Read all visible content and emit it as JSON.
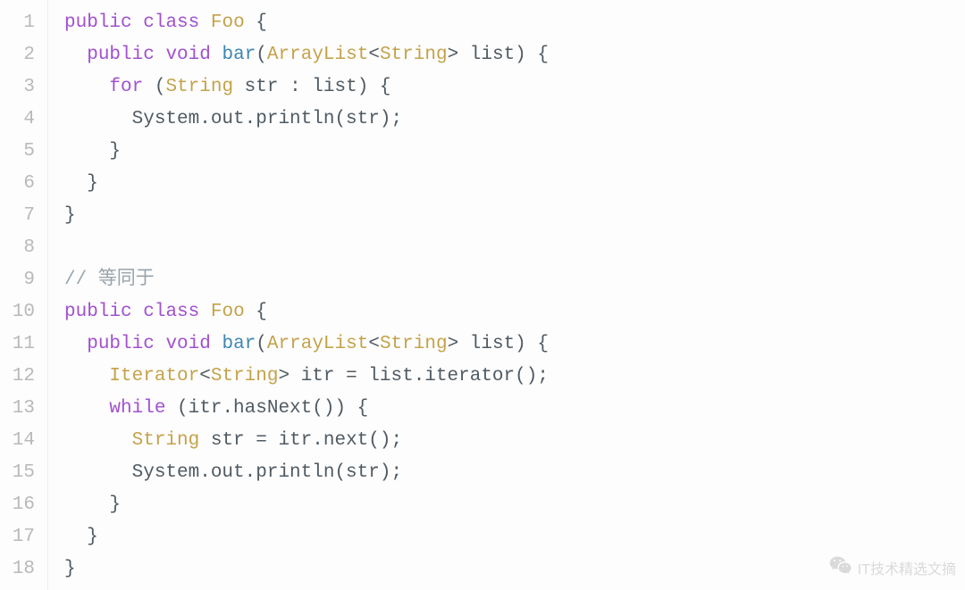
{
  "lines": [
    {
      "n": 1,
      "tokens": [
        [
          "kw",
          "public"
        ],
        [
          "plain",
          " "
        ],
        [
          "kw",
          "class"
        ],
        [
          "plain",
          " "
        ],
        [
          "type",
          "Foo"
        ],
        [
          "plain",
          " {"
        ]
      ]
    },
    {
      "n": 2,
      "tokens": [
        [
          "plain",
          "  "
        ],
        [
          "kw",
          "public"
        ],
        [
          "plain",
          " "
        ],
        [
          "kw",
          "void"
        ],
        [
          "plain",
          " "
        ],
        [
          "fn",
          "bar"
        ],
        [
          "plain",
          "("
        ],
        [
          "type",
          "ArrayList"
        ],
        [
          "plain",
          "<"
        ],
        [
          "type",
          "String"
        ],
        [
          "plain",
          "> list) {"
        ]
      ]
    },
    {
      "n": 3,
      "tokens": [
        [
          "plain",
          "    "
        ],
        [
          "kw",
          "for"
        ],
        [
          "plain",
          " ("
        ],
        [
          "type",
          "String"
        ],
        [
          "plain",
          " str : list) {"
        ]
      ]
    },
    {
      "n": 4,
      "tokens": [
        [
          "plain",
          "      System.out.println(str);"
        ]
      ]
    },
    {
      "n": 5,
      "tokens": [
        [
          "plain",
          "    }"
        ]
      ]
    },
    {
      "n": 6,
      "tokens": [
        [
          "plain",
          "  }"
        ]
      ]
    },
    {
      "n": 7,
      "tokens": [
        [
          "plain",
          "}"
        ]
      ]
    },
    {
      "n": 8,
      "tokens": [
        [
          "plain",
          ""
        ]
      ]
    },
    {
      "n": 9,
      "tokens": [
        [
          "cmt",
          "// 等同于"
        ]
      ]
    },
    {
      "n": 10,
      "tokens": [
        [
          "kw",
          "public"
        ],
        [
          "plain",
          " "
        ],
        [
          "kw",
          "class"
        ],
        [
          "plain",
          " "
        ],
        [
          "type",
          "Foo"
        ],
        [
          "plain",
          " {"
        ]
      ]
    },
    {
      "n": 11,
      "tokens": [
        [
          "plain",
          "  "
        ],
        [
          "kw",
          "public"
        ],
        [
          "plain",
          " "
        ],
        [
          "kw",
          "void"
        ],
        [
          "plain",
          " "
        ],
        [
          "fn",
          "bar"
        ],
        [
          "plain",
          "("
        ],
        [
          "type",
          "ArrayList"
        ],
        [
          "plain",
          "<"
        ],
        [
          "type",
          "String"
        ],
        [
          "plain",
          "> list) {"
        ]
      ]
    },
    {
      "n": 12,
      "tokens": [
        [
          "plain",
          "    "
        ],
        [
          "type",
          "Iterator"
        ],
        [
          "plain",
          "<"
        ],
        [
          "type",
          "String"
        ],
        [
          "plain",
          "> itr = list.iterator();"
        ]
      ]
    },
    {
      "n": 13,
      "tokens": [
        [
          "plain",
          "    "
        ],
        [
          "kw",
          "while"
        ],
        [
          "plain",
          " (itr.hasNext()) {"
        ]
      ]
    },
    {
      "n": 14,
      "tokens": [
        [
          "plain",
          "      "
        ],
        [
          "type",
          "String"
        ],
        [
          "plain",
          " str = itr.next();"
        ]
      ]
    },
    {
      "n": 15,
      "tokens": [
        [
          "plain",
          "      System.out.println(str);"
        ]
      ]
    },
    {
      "n": 16,
      "tokens": [
        [
          "plain",
          "    }"
        ]
      ]
    },
    {
      "n": 17,
      "tokens": [
        [
          "plain",
          "  }"
        ]
      ]
    },
    {
      "n": 18,
      "tokens": [
        [
          "plain",
          "}"
        ]
      ]
    }
  ],
  "watermark": {
    "text": "IT技术精选文摘",
    "icon": "wechat-icon"
  }
}
